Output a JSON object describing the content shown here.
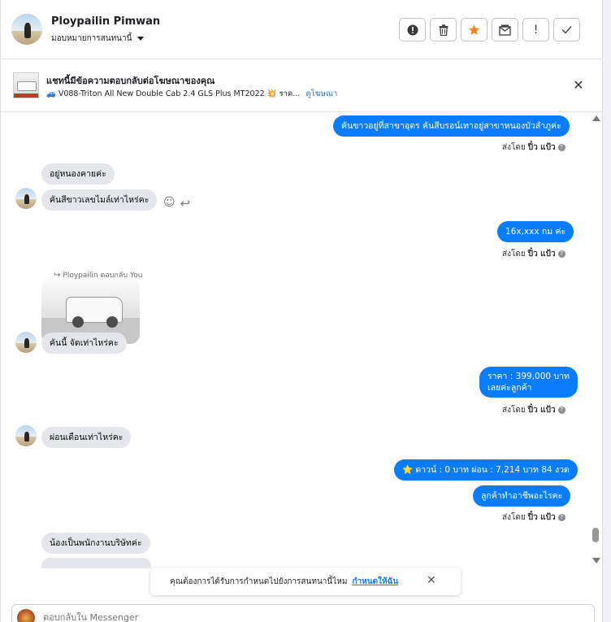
{
  "header": {
    "contact_name": "Ploypailin Pimwan",
    "assign_label": "มอบหมายการสนทนานี้",
    "buttons": [
      {
        "name": "spam-button",
        "glyph": "!"
      },
      {
        "name": "delete-button",
        "glyph": "trash"
      },
      {
        "name": "star-button",
        "glyph": "★"
      },
      {
        "name": "mark-unread-button",
        "glyph": "mail"
      },
      {
        "name": "follow-up-button",
        "glyph": "!"
      },
      {
        "name": "mark-done-button",
        "glyph": "✓"
      }
    ]
  },
  "ad_banner": {
    "title": "แชทนี้มีข้อความตอบกลับต่อโฆษณาของคุณ",
    "subtitle": "🚙 V088-Triton All New Double Cab 2.4 GLS Plus MT2022 💥 ราค...",
    "link": "ดูโฆษณา"
  },
  "messages": [
    {
      "dir": "out",
      "text": "คันขาวอยู่ที่สาขาอุดร  คันสีบรอน์เทาอยู่สาขาหนองบัวลำภูค่ะ"
    },
    {
      "dir": "in",
      "text": "อยู่หนองคายค่ะ"
    },
    {
      "dir": "in",
      "text": "คันสีขาวเลขไมล์เท่าไหร่คะ"
    },
    {
      "dir": "out",
      "text": "16x,xxx  กม ค่ะ"
    },
    {
      "dir": "in",
      "reply_note": "Ploypailin ตอบกลับ You",
      "text": "คันนี้ จัดเท่าไหร่คะ"
    },
    {
      "dir": "out",
      "text_line1": "ราคา : 399,000 บาท",
      "text_line2": "เลยค่ะลูกค้า"
    },
    {
      "dir": "in",
      "text": "ผ่อนเดือนเท่าไหร่คะ"
    },
    {
      "dir": "out",
      "text": "⭐ ดาวน์ : 0 บาท ผ่อน : 7,214 บาท 84 งวด"
    },
    {
      "dir": "out",
      "text": "ลูกค้าทำอาชีพอะไรคะ"
    },
    {
      "dir": "in",
      "text": "น้องเป็นพนักงานบริษัทค่ะ"
    }
  ],
  "sent_by": {
    "prefix": "ส่งโดย",
    "name": "ปิ๋ว แป้ว",
    "help": "?"
  },
  "notice": {
    "text": "คุณต้องการได้รับการกำหนดไปยังการสนทนานี้ไหม",
    "link": "กำหนดให้ฉัน",
    "close": "✕"
  },
  "composer": {
    "placeholder": "ตอบกลับใน Messenger"
  },
  "colors": {
    "outgoing": "#0a7cff",
    "incoming": "#e4e6eb",
    "star": "#f5821f",
    "link": "#1877f2"
  }
}
